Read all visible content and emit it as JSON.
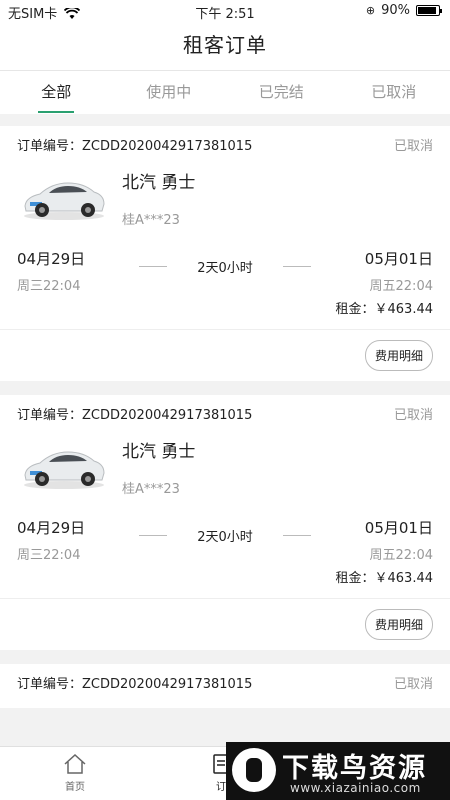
{
  "status_bar": {
    "carrier": "无SIM卡",
    "time": "下午 2:51",
    "battery": "90%"
  },
  "header": {
    "title": "租客订单"
  },
  "tabs": [
    {
      "label": "全部",
      "active": true
    },
    {
      "label": "使用中",
      "active": false
    },
    {
      "label": "已完结",
      "active": false
    },
    {
      "label": "已取消",
      "active": false
    }
  ],
  "orders": [
    {
      "order_no": "订单编号：ZCDD2020042917381015",
      "status": "已取消",
      "car_name": "北汽 勇士",
      "plate": "桂A***23",
      "start_date": "04月29日",
      "start_time": "周三22:04",
      "duration": "2天0小时",
      "end_date": "05月01日",
      "end_time": "周五22:04",
      "rent": "租金：￥463.44",
      "fee_button": "费用明细"
    },
    {
      "order_no": "订单编号：ZCDD2020042917381015",
      "status": "已取消",
      "car_name": "北汽 勇士",
      "plate": "桂A***23",
      "start_date": "04月29日",
      "start_time": "周三22:04",
      "duration": "2天0小时",
      "end_date": "05月01日",
      "end_time": "周五22:04",
      "rent": "租金：￥463.44",
      "fee_button": "费用明细"
    },
    {
      "order_no": "订单编号：ZCDD2020042917381015",
      "status": "已取消"
    }
  ],
  "bottom_nav": {
    "home_label": "首页",
    "orders_label": "订"
  },
  "watermark": {
    "title": "下载鸟资源",
    "url": "www.xiazainiao.com"
  },
  "colors": {
    "accent": "#2aa070"
  }
}
